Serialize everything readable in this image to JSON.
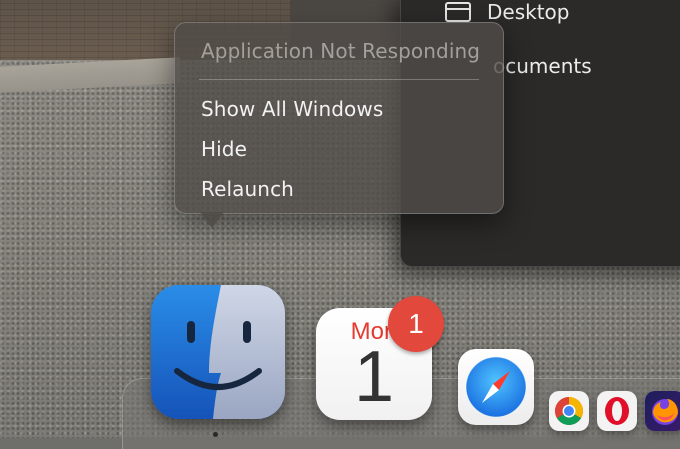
{
  "context_menu": {
    "items": [
      {
        "label": "Application Not Responding",
        "enabled": false
      },
      {
        "label": "Show All Windows",
        "enabled": true
      },
      {
        "label": "Hide",
        "enabled": true
      },
      {
        "label": "Relaunch",
        "enabled": true
      }
    ]
  },
  "finder_window": {
    "sidebar": {
      "desktop_label": "Desktop",
      "documents_label": "ocuments"
    }
  },
  "dock": {
    "apps": [
      {
        "name": "Finder",
        "icon": "finder-icon"
      },
      {
        "name": "Calendar",
        "icon": "calendar-icon",
        "month": "Mon",
        "day": "1",
        "badge": "1"
      },
      {
        "name": "Safari",
        "icon": "safari-icon"
      },
      {
        "name": "Chrome",
        "icon": "chrome-icon"
      },
      {
        "name": "Opera",
        "icon": "opera-icon"
      },
      {
        "name": "Firefox",
        "icon": "firefox-icon"
      }
    ]
  },
  "colors": {
    "badge": "#e2483c",
    "calendar_month": "#e53a2f",
    "menu_bg": "#504c48"
  }
}
